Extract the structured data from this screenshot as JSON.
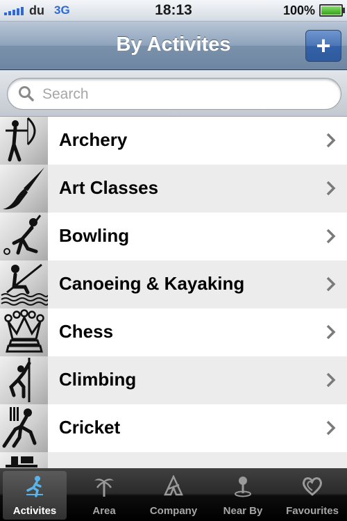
{
  "status_bar": {
    "carrier": "du",
    "network": "3G",
    "time": "18:13",
    "battery": "100%"
  },
  "nav": {
    "title": "By Activites",
    "add_label": "+"
  },
  "search": {
    "placeholder": "Search",
    "value": ""
  },
  "activities": [
    {
      "label": "Archery",
      "icon": "archery-icon"
    },
    {
      "label": "Art Classes",
      "icon": "paintbrush-icon"
    },
    {
      "label": "Bowling",
      "icon": "bowling-icon"
    },
    {
      "label": "Canoeing & Kayaking",
      "icon": "canoe-icon"
    },
    {
      "label": "Chess",
      "icon": "chess-queen-icon"
    },
    {
      "label": "Climbing",
      "icon": "climbing-icon"
    },
    {
      "label": "Cricket",
      "icon": "cricket-icon"
    }
  ],
  "tabs": [
    {
      "label": "Activites",
      "icon": "runner-icon",
      "active": true
    },
    {
      "label": "Area",
      "icon": "palm-tree-icon",
      "active": false
    },
    {
      "label": "Company",
      "icon": "company-logo-icon",
      "active": false
    },
    {
      "label": "Near By",
      "icon": "map-pin-icon",
      "active": false
    },
    {
      "label": "Favourites",
      "icon": "heart-icon",
      "active": false
    }
  ]
}
